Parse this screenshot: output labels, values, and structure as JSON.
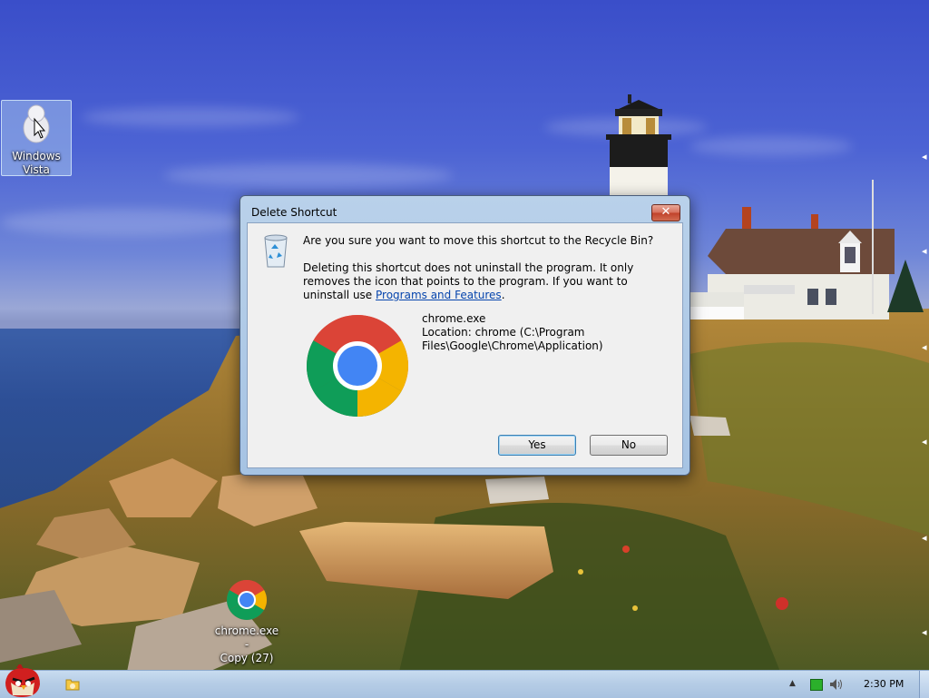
{
  "desktop": {
    "icons": [
      {
        "label_line1": "Windows",
        "label_line2": "Vista"
      },
      {
        "label_line1": "chrome.exe -",
        "label_line2": "Copy (27)"
      }
    ]
  },
  "dialog": {
    "title": "Delete Shortcut",
    "close_label": "✕",
    "question": "Are you sure you want to move this shortcut to the Recycle Bin?",
    "info_text": "Deleting this shortcut does not uninstall the program. It only removes the icon that points to the program. If you want to uninstall use ",
    "link_text": "Programs and Features",
    "info_suffix": ".",
    "file_name": "chrome.exe",
    "file_location": "Location: chrome (C:\\Program Files\\Google\\Chrome\\Application)",
    "yes_label": "Yes",
    "no_label": "No"
  },
  "taskbar": {
    "clock": "2:30 PM",
    "tray_up_arrow": "▲"
  },
  "colors": {
    "sky": "#4c63d4",
    "dialog_frame": "#b9d1ea",
    "dialog_body": "#f0f0f0",
    "link": "#0645ad",
    "close_button": "#c0422a"
  },
  "icons": [
    "recycle-bin-icon",
    "chrome-icon",
    "close-icon",
    "angry-birds-icon",
    "folder-icon",
    "network-icon",
    "volume-icon",
    "vista-icon"
  ]
}
